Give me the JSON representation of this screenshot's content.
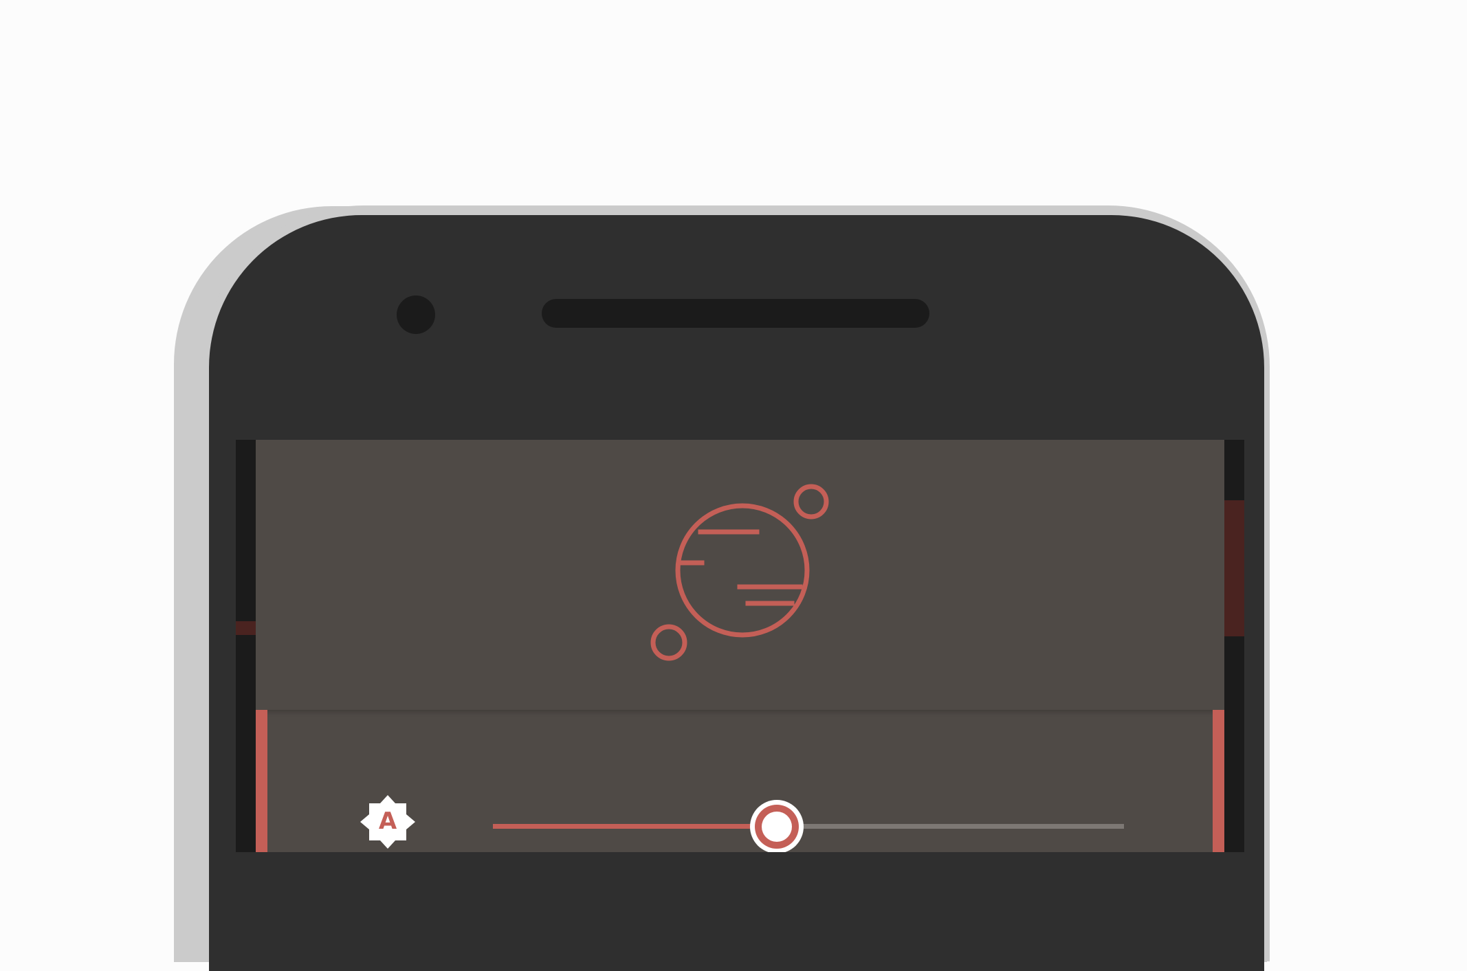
{
  "colors": {
    "background": "#fcfcfc",
    "device_body": "#2f2f2f",
    "screen_surface": "#4f4a46",
    "accent": "#c45f57",
    "track_inactive": "#7d7874"
  },
  "brightness": {
    "auto_icon": "auto-brightness-icon",
    "auto_label": "A",
    "level": 0.45
  },
  "app_logo": {
    "icon": "planet-logo-icon"
  }
}
